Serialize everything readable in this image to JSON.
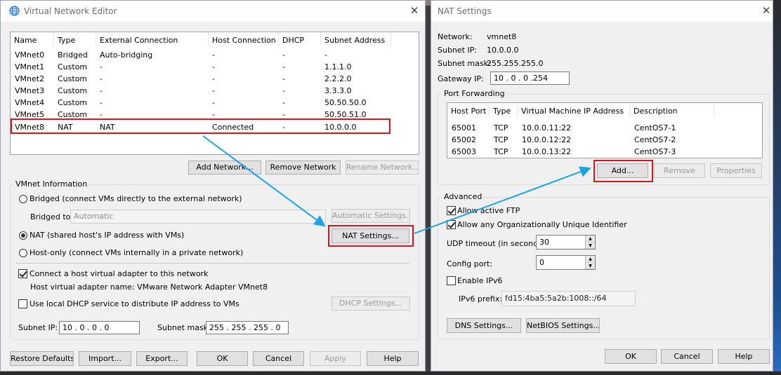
{
  "vne": {
    "title": "Virtual Network Editor",
    "columns": [
      "Name",
      "Type",
      "External Connection",
      "Host Connection",
      "DHCP",
      "Subnet Address"
    ],
    "rows": [
      [
        "VMnet0",
        "Bridged",
        "Auto-bridging",
        "-",
        "-",
        "-"
      ],
      [
        "VMnet1",
        "Custom",
        "-",
        "-",
        "-",
        "1.1.1.0"
      ],
      [
        "VMnet2",
        "Custom",
        "-",
        "-",
        "-",
        "2.2.2.0"
      ],
      [
        "VMnet3",
        "Custom",
        "-",
        "-",
        "-",
        "3.3.3.0"
      ],
      [
        "VMnet4",
        "Custom",
        "-",
        "-",
        "-",
        "50.50.50.0"
      ],
      [
        "VMnet5",
        "Custom",
        "-",
        "-",
        "-",
        "50.50.51.0"
      ],
      [
        "VMnet8",
        "NAT",
        "NAT",
        "Connected",
        "-",
        "10.0.0.0"
      ]
    ],
    "add_network": "Add Network...",
    "remove_network": "Remove Network",
    "rename_network": "Rename Network...",
    "info_title": "VMnet Information",
    "bridged_label": "Bridged (connect VMs directly to the external network)",
    "bridged_to_label": "Bridged to:",
    "bridged_to_value": "Automatic",
    "auto_settings": "Automatic Settings...",
    "nat_label": "NAT (shared host's IP address with VMs)",
    "nat_settings": "NAT Settings...",
    "hostonly_label": "Host-only (connect VMs internally in a private network)",
    "connect_adapter_label": "Connect a host virtual adapter to this network",
    "adapter_name_text": "Host virtual adapter name: VMware Network Adapter VMnet8",
    "dhcp_label": "Use local DHCP service to distribute IP address to VMs",
    "dhcp_settings": "DHCP Settings...",
    "subnet_ip_label": "Subnet IP:",
    "subnet_ip_value": "10 . 0 . 0 . 0",
    "subnet_mask_label": "Subnet mask:",
    "subnet_mask_value": "255 . 255 . 255 . 0",
    "restore": "Restore Defaults",
    "import": "Import...",
    "export": "Export...",
    "ok": "OK",
    "cancel": "Cancel",
    "apply": "Apply",
    "help": "Help"
  },
  "nat": {
    "title": "NAT Settings",
    "network_label": "Network:",
    "network_value": "vmnet8",
    "subnet_ip_label": "Subnet IP:",
    "subnet_ip_value": "10.0.0.0",
    "subnet_mask_label": "Subnet mask:",
    "subnet_mask_value": "255.255.255.0",
    "gateway_label": "Gateway IP:",
    "gateway_value": "10 . 0 . 0 .254",
    "pf_title": "Port Forwarding",
    "pf_columns": [
      "Host Port",
      "Type",
      "Virtual Machine IP Address",
      "Description"
    ],
    "pf_rows": [
      [
        "65001",
        "TCP",
        "10.0.0.11:22",
        "CentOS7-1"
      ],
      [
        "65002",
        "TCP",
        "10.0.0.12:22",
        "CentOS7-2"
      ],
      [
        "65003",
        "TCP",
        "10.0.0.13:22",
        "CentOS7-3"
      ]
    ],
    "add": "Add...",
    "remove": "Remove",
    "properties": "Properties",
    "adv_title": "Advanced",
    "allow_ftp": "Allow active FTP",
    "allow_oui": "Allow any Organizationally Unique Identifier",
    "udp_label": "UDP timeout (in seconds):",
    "udp_value": "30",
    "config_port_label": "Config port:",
    "config_port_value": "0",
    "enable_ipv6": "Enable IPv6",
    "ipv6_prefix_label": "IPv6 prefix:",
    "ipv6_prefix_value": "fd15:4ba5:5a2b:1008::/64",
    "dns": "DNS Settings...",
    "netbios": "NetBIOS Settings...",
    "ok": "OK",
    "cancel": "Cancel",
    "help": "Help"
  },
  "colors": {
    "highlight": "#e0101a",
    "arrow": "#1aa3e8"
  }
}
